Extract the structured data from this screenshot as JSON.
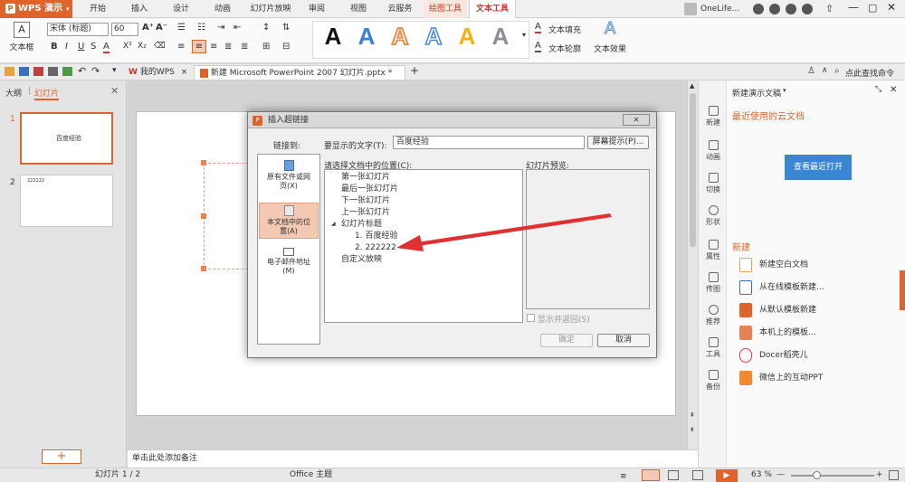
{
  "app": {
    "name": "WPS 演示"
  },
  "menu": {
    "tabs": [
      "开始",
      "插入",
      "设计",
      "动画",
      "幻灯片放映",
      "审阅",
      "视图",
      "云服务",
      "绘图工具",
      "文本工具"
    ],
    "account": "OneLife..."
  },
  "ribbon": {
    "textbox_label": "文本框",
    "font_name": "宋体 (标题)",
    "font_size": "60",
    "text_fill": "文本填充",
    "text_outline": "文本轮廓",
    "text_effect": "文本效果",
    "wordart_letter": "A"
  },
  "docbar": {
    "tab_wps": "我的WPS",
    "tab_doc": "新建 Microsoft PowerPoint 2007 幻灯片.pptx *",
    "search": "点此查找命令"
  },
  "leftpanel": {
    "tab_outline": "大纲",
    "tab_slides": "幻灯片",
    "slide1_num": "1",
    "slide1_text": "百度经验",
    "slide2_num": "2",
    "slide2_text": "222222"
  },
  "notes_placeholder": "单击此处添加备注",
  "status": {
    "slide_count": "幻灯片 1 / 2",
    "theme": "Office 主题",
    "zoom": "63 %"
  },
  "rightstrip": [
    "新建",
    "动画",
    "切换",
    "形状",
    "属性",
    "传图",
    "推荐",
    "工具",
    "备份"
  ],
  "rightpanel": {
    "title": "新建演示文稿",
    "recent_heading": "最近使用的云文档",
    "view_recent_btn": "查看最近打开",
    "new_heading": "新建",
    "items": [
      "新建空白文档",
      "从在线模板新建...",
      "从默认模板新建",
      "本机上的模板...",
      "Docer稻壳儿",
      "微信上的互动PPT"
    ]
  },
  "dialog": {
    "title": "插入超链接",
    "link_to": "链接到:",
    "display_text_label": "要显示的文字(T):",
    "display_text_value": "百度经验",
    "screen_tip_btn": "屏幕提示(P)...",
    "nav_existing": "原有文件或网页(X)",
    "nav_this_doc": "本文档中的位置(A)",
    "nav_email": "电子邮件地址(M)",
    "location_label": "请选择文档中的位置(C):",
    "preview_label": "幻灯片预览:",
    "tree": [
      "第一张幻灯片",
      "最后一张幻灯片",
      "下一张幻灯片",
      "上一张幻灯片",
      "幻灯片标题",
      "1. 百度经验",
      "2. 222222",
      "自定义放映"
    ],
    "show_return": "显示并返回(S)",
    "ok": "确定",
    "cancel": "取消"
  },
  "colors": {
    "accent": "#e0632b",
    "blue_btn": "#3a85d4",
    "wordart_blue": "#3b7fd0",
    "wordart_orange": "#e8914b",
    "wordart_gold": "#f0b416",
    "arrow_red": "#e03030"
  }
}
